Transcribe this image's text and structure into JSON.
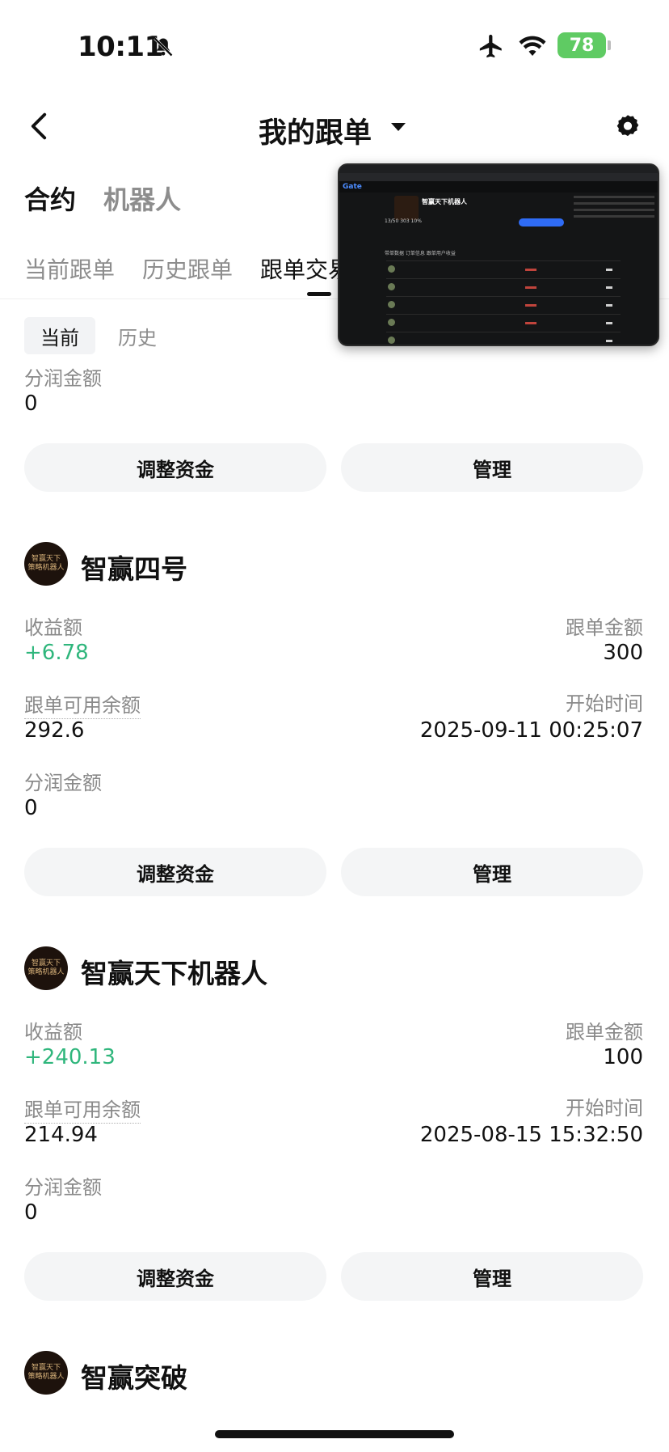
{
  "status_bar": {
    "time": "10:11",
    "battery": "78"
  },
  "header": {
    "title": "我的跟单"
  },
  "tabs_primary": [
    "合约",
    "机器人"
  ],
  "tabs_secondary": [
    "当前跟单",
    "历史跟单",
    "跟单交易"
  ],
  "segment": [
    "当前",
    "历史"
  ],
  "overlay": {
    "logo": "Gate",
    "name": "智赢天下机器人",
    "stats": "13/50   303   10%",
    "subtabs": "带单数据  订单信息  跟单用户收益"
  },
  "partial_card": {
    "profit_share_label": "分润金额",
    "profit_share_value": "0",
    "adjust_label": "调整资金",
    "manage_label": "管理"
  },
  "cards": [
    {
      "avatar_text": [
        "智赢天下",
        "策略机器人"
      ],
      "name": "智赢四号",
      "pnl_label": "收益额",
      "pnl": "+6.78",
      "amount_label": "跟单金额",
      "amount": "300",
      "available_label": "跟单可用余额",
      "available": "292.6",
      "start_label": "开始时间",
      "start": "2025-09-11 00:25:07",
      "share_label": "分润金额",
      "share": "0",
      "adjust_label": "调整资金",
      "manage_label": "管理"
    },
    {
      "avatar_text": [
        "智赢天下",
        "策略机器人"
      ],
      "name": "智赢天下机器人",
      "pnl_label": "收益额",
      "pnl": "+240.13",
      "amount_label": "跟单金额",
      "amount": "100",
      "available_label": "跟单可用余额",
      "available": "214.94",
      "start_label": "开始时间",
      "start": "2025-08-15 15:32:50",
      "share_label": "分润金额",
      "share": "0",
      "adjust_label": "调整资金",
      "manage_label": "管理"
    },
    {
      "avatar_text": [
        "智赢天下",
        "策略机器人"
      ],
      "name": "智赢突破"
    }
  ]
}
